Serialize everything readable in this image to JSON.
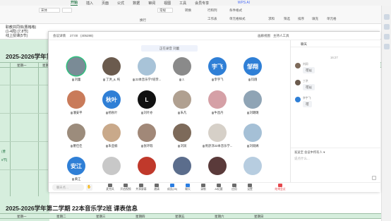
{
  "spreadsheet": {
    "tabs": [
      "开始",
      "插入",
      "页面",
      "公式",
      "数据",
      "审阅",
      "视图",
      "工具",
      "会员专享"
    ],
    "active_tab": "开始",
    "wps_ai": "WPS AI",
    "ribbon_buttons": {
      "font": "宋体",
      "wrap": "换行",
      "general": "常规",
      "convert": "转换",
      "row_col": "行和列",
      "worksheet": "工作表",
      "cond_format": "条件格式",
      "cell_style": "单元格样式",
      "sum": "求和",
      "filter": "筛选",
      "sort": "排序",
      "fill": "填充",
      "cell": "单元格"
    },
    "formula_lines": [
      "职教共同体(曹格格)",
      "(1-4周) [7,8节]",
      "线上授课(5节)"
    ],
    "title_top": "2025-2026学年第",
    "title_bottom": "2025-2026学年第二学期    22本音乐学2班  课表信息",
    "weekday_labels_top": [
      "星期一",
      "星期二"
    ],
    "weekday_labels_bottom": [
      "星期一",
      "星期二",
      "星期三",
      "星期四",
      "星期五",
      "星期六",
      "星期日"
    ],
    "side_text_1": "(曹",
    "side_text_2": "8节]"
  },
  "meeting": {
    "toolbar": {
      "meeting_info": "会议详情",
      "time": "27:00",
      "meeting_id": "(405288)",
      "grid_label": "画廊视图",
      "host_tools": "主持人工具"
    },
    "share_notice": "正在录音 刘蕾",
    "participants": [
      {
        "name": "刘蕾",
        "initials": "",
        "color": "#7a8b96",
        "active": true
      },
      {
        "name": "丁洪_a, 纯",
        "initials": "",
        "color": "#6b5b4e",
        "active": false
      },
      {
        "name": "22本音乐学7班李...",
        "initials": "",
        "color": "#a8c3d8",
        "active": false
      },
      {
        "name": "z.",
        "initials": "",
        "color": "#8a8a8a",
        "active": false
      },
      {
        "name": "李宇飞",
        "initials": "宇飞",
        "color": "#2f7fd6",
        "active": false
      },
      {
        "name": "钧翔",
        "initials": "邹翔",
        "color": "#2f7fd6",
        "active": false
      },
      {
        "name": "潘安平",
        "initials": "",
        "color": "#c97b5a",
        "active": false
      },
      {
        "name": "杨秋叶",
        "initials": "秋叶",
        "color": "#2f7fd6",
        "active": false
      },
      {
        "name": "刘叶亦",
        "initials": "L",
        "color": "#111111",
        "active": false
      },
      {
        "name": "朱凡",
        "initials": "",
        "color": "#b0a090",
        "active": false
      },
      {
        "name": "牛昌丹",
        "initials": "",
        "color": "#d5a0a6",
        "active": false
      },
      {
        "name": "刘璐璐",
        "initials": "",
        "color": "#8fa4b5",
        "active": false
      },
      {
        "name": "瞿佳佳",
        "initials": "",
        "color": "#9c8c7c",
        "active": false
      },
      {
        "name": "朱亚楠",
        "initials": "",
        "color": "#c9a98a",
        "active": false
      },
      {
        "name": "张环瑕",
        "initials": "",
        "color": "#a18878",
        "active": false
      },
      {
        "name": "刘润",
        "initials": "",
        "color": "#7d6a5a",
        "active": false
      },
      {
        "name": "佟舒淳22本音乐学...",
        "initials": "",
        "color": "#d6d0c8",
        "active": false
      },
      {
        "name": "刘雨嫣",
        "initials": "",
        "color": "#a5c0d6",
        "active": false
      },
      {
        "name": "黄江",
        "initials": "安江",
        "color": "#2f7fd6",
        "active": false
      },
      {
        "name": "",
        "initials": "",
        "color": "#c8c8c8",
        "active": false
      },
      {
        "name": "",
        "initials": "",
        "color": "#c0392b",
        "active": false
      },
      {
        "name": "",
        "initials": "",
        "color": "#5b6d8c",
        "active": false
      },
      {
        "name": "",
        "initials": "",
        "color": "#5a3a3a",
        "active": false
      },
      {
        "name": "",
        "initials": "",
        "color": "#b7cde0",
        "active": false
      }
    ],
    "bottom": {
      "speak_placeholder": "聊天点…",
      "hand": "✋",
      "buttons": [
        "麦克风",
        "开启视频",
        "共享屏幕",
        "邀请",
        "成员(25)",
        "聊天",
        "录制",
        "AI纪要",
        "应用",
        "设置"
      ],
      "leave": "结束会议"
    },
    "chat": {
      "title": "聊天",
      "time": "16:27",
      "messages": [
        {
          "name": "刘润",
          "text": "可以",
          "color": "#7d6a5a"
        },
        {
          "name": "丁洪",
          "text": "可以",
          "color": "#6b5b4e"
        },
        {
          "name": "李宇飞",
          "text": "可",
          "color": "#2f7fd6"
        }
      ],
      "send_to_label": "发送至",
      "send_to_value": "会议中所有人",
      "input_placeholder": "说点什么..."
    }
  }
}
